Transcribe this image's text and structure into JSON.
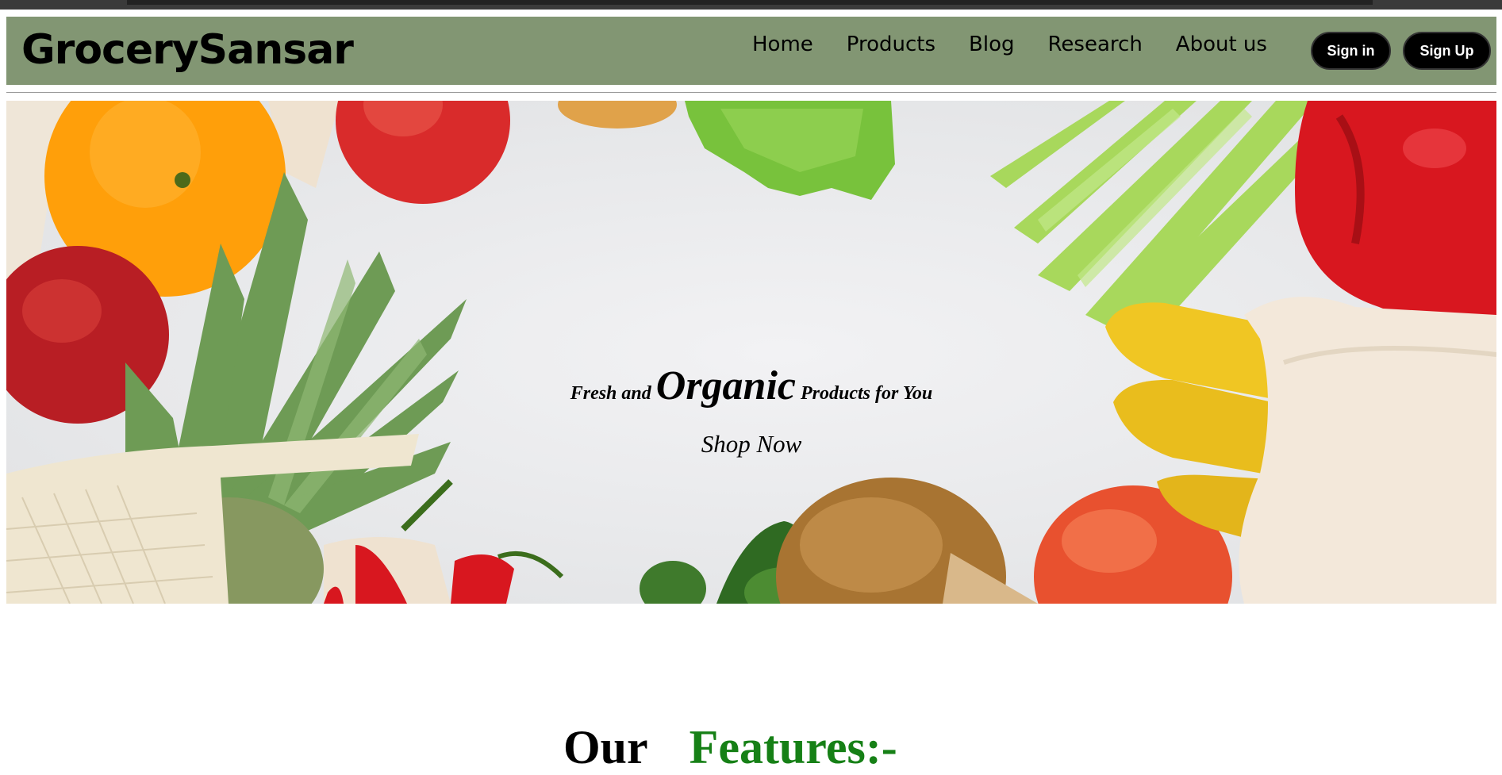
{
  "header": {
    "logo": "GrocerySansar",
    "nav": [
      "Home",
      "Products",
      "Blog",
      "Research",
      "About us"
    ],
    "sign_in": "Sign in",
    "sign_up": "Sign Up"
  },
  "hero": {
    "tagline_part1": "Fresh and ",
    "tagline_emphasis": "Organic",
    "tagline_part2": " Products for You",
    "cta": "Shop Now"
  },
  "section": {
    "word1": "Our",
    "word2": "Features:-"
  },
  "colors": {
    "navbar_bg": "#829673",
    "features_accent": "#168016",
    "button_bg": "#000000"
  }
}
